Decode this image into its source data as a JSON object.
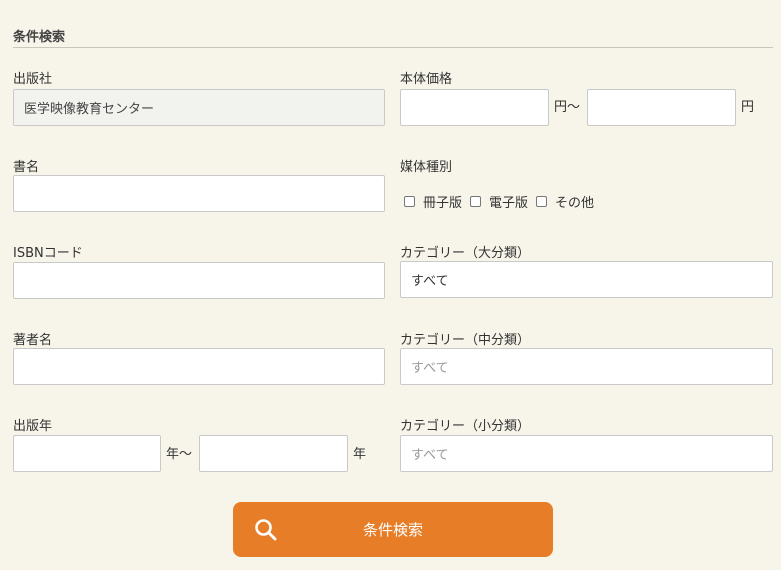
{
  "section": {
    "title": "条件検索"
  },
  "publisher": {
    "label": "出版社",
    "value": "医学映像教育センター"
  },
  "price": {
    "label": "本体価格",
    "min_value": "",
    "max_value": "",
    "unit_from": "円〜",
    "unit_to": "円"
  },
  "title": {
    "label": "書名",
    "value": ""
  },
  "media": {
    "label": "媒体種別",
    "options": [
      {
        "label": "冊子版",
        "checked": false
      },
      {
        "label": "電子版",
        "checked": false
      },
      {
        "label": "その他",
        "checked": false
      }
    ]
  },
  "isbn": {
    "label": "ISBNコード",
    "value": ""
  },
  "category_large": {
    "label": "カテゴリー（大分類）",
    "value": "すべて"
  },
  "author": {
    "label": "著者名",
    "value": ""
  },
  "category_medium": {
    "label": "カテゴリー（中分類）",
    "value": "すべて"
  },
  "year": {
    "label": "出版年",
    "from_value": "",
    "to_value": "",
    "unit_from": "年〜",
    "unit_to": "年"
  },
  "category_small": {
    "label": "カテゴリー（小分類）",
    "value": "すべて"
  },
  "search_button": {
    "label": "条件検索",
    "icon": "search-icon",
    "color": "#e87d27"
  }
}
